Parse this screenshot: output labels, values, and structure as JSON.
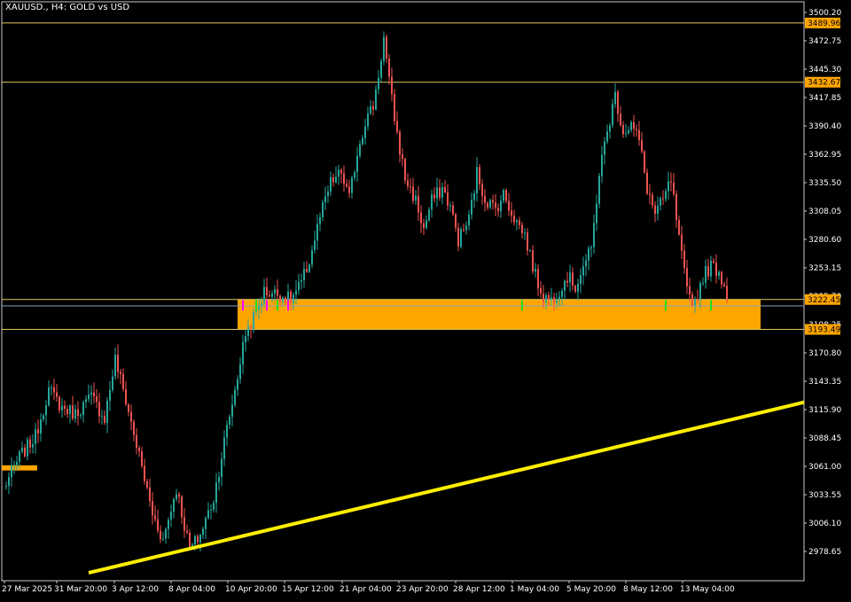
{
  "window": {
    "title": "XAUUSD., H4:  GOLD vs USD"
  },
  "colors": {
    "background": "#000000",
    "axis": "#ffffff",
    "bull": "#26a69a",
    "bear": "#ef5350",
    "level_line": "#e3c75a",
    "level_tag": "#ffa500",
    "zone": "#ffa500",
    "trendline": "#ffee00",
    "signal_green": "#22dd22",
    "signal_magenta": "#ff00ff"
  },
  "chart_data": {
    "type": "candlestick",
    "symbol": "XAUUSD.",
    "timeframe": "H4",
    "description_text": "GOLD vs USD",
    "ylim": [
      2956.6,
      3510.8
    ],
    "y_ticks": [
      "3500.20",
      "3472.75",
      "3445.30",
      "3417.85",
      "3390.40",
      "3362.95",
      "3335.50",
      "3308.05",
      "3280.60",
      "3253.15",
      "3225.70",
      "3198.25",
      "3170.80",
      "3143.35",
      "3115.90",
      "3088.45",
      "3061.00",
      "3033.55",
      "3006.10",
      "2978.65"
    ],
    "x_ticks": [
      "27 Mar 2025",
      "31 Mar 20:00",
      "3 Apr 12:00",
      "8 Apr 04:00",
      "10 Apr 20:00",
      "15 Apr 12:00",
      "21 Apr 04:00",
      "23 Apr 20:00",
      "28 Apr 12:00",
      "1 May 04:00",
      "5 May 20:00",
      "8 May 12:00",
      "13 May 04:00"
    ],
    "price_levels": [
      "3489.96",
      "3432.67",
      "3222.45",
      "3193.49"
    ],
    "zone": {
      "from": 3193.49,
      "to": 3222.45
    },
    "small_zone": {
      "from": 3057.0,
      "to": 3062.0
    },
    "trendline": {
      "start_price": 2958.0,
      "end_price": 3123.0
    },
    "anchors": [
      [
        0,
        3040
      ],
      [
        6,
        3070
      ],
      [
        12,
        3090
      ],
      [
        17,
        3135
      ],
      [
        22,
        3118
      ],
      [
        27,
        3112
      ],
      [
        33,
        3128
      ],
      [
        38,
        3108
      ],
      [
        42,
        3165
      ],
      [
        46,
        3125
      ],
      [
        52,
        3060
      ],
      [
        56,
        3015
      ],
      [
        60,
        2990
      ],
      [
        65,
        3040
      ],
      [
        70,
        2980
      ],
      [
        74,
        2995
      ],
      [
        79,
        3030
      ],
      [
        83,
        3085
      ],
      [
        87,
        3135
      ],
      [
        91,
        3190
      ],
      [
        95,
        3210
      ],
      [
        98,
        3230
      ],
      [
        103,
        3228
      ],
      [
        108,
        3222
      ],
      [
        112,
        3238
      ],
      [
        115,
        3260
      ],
      [
        119,
        3302
      ],
      [
        123,
        3335
      ],
      [
        127,
        3345
      ],
      [
        130,
        3320
      ],
      [
        133,
        3365
      ],
      [
        136,
        3395
      ],
      [
        139,
        3410
      ],
      [
        141,
        3440
      ],
      [
        143,
        3475
      ],
      [
        145,
        3432
      ],
      [
        148,
        3382
      ],
      [
        151,
        3340
      ],
      [
        155,
        3318
      ],
      [
        158,
        3290
      ],
      [
        161,
        3318
      ],
      [
        165,
        3330
      ],
      [
        168,
        3312
      ],
      [
        171,
        3280
      ],
      [
        175,
        3300
      ],
      [
        178,
        3345
      ],
      [
        181,
        3320
      ],
      [
        185,
        3310
      ],
      [
        188,
        3324
      ],
      [
        192,
        3302
      ],
      [
        196,
        3285
      ],
      [
        200,
        3245
      ],
      [
        203,
        3225
      ],
      [
        206,
        3222
      ],
      [
        209,
        3232
      ],
      [
        212,
        3245
      ],
      [
        215,
        3235
      ],
      [
        218,
        3255
      ],
      [
        221,
        3270
      ],
      [
        224,
        3345
      ],
      [
        227,
        3385
      ],
      [
        230,
        3420
      ],
      [
        233,
        3385
      ],
      [
        236,
        3392
      ],
      [
        239,
        3376
      ],
      [
        242,
        3330
      ],
      [
        245,
        3305
      ],
      [
        248,
        3318
      ],
      [
        251,
        3338
      ],
      [
        254,
        3280
      ],
      [
        257,
        3230
      ],
      [
        260,
        3220
      ],
      [
        263,
        3245
      ],
      [
        266,
        3255
      ],
      [
        269,
        3250
      ],
      [
        272,
        3228
      ]
    ]
  }
}
